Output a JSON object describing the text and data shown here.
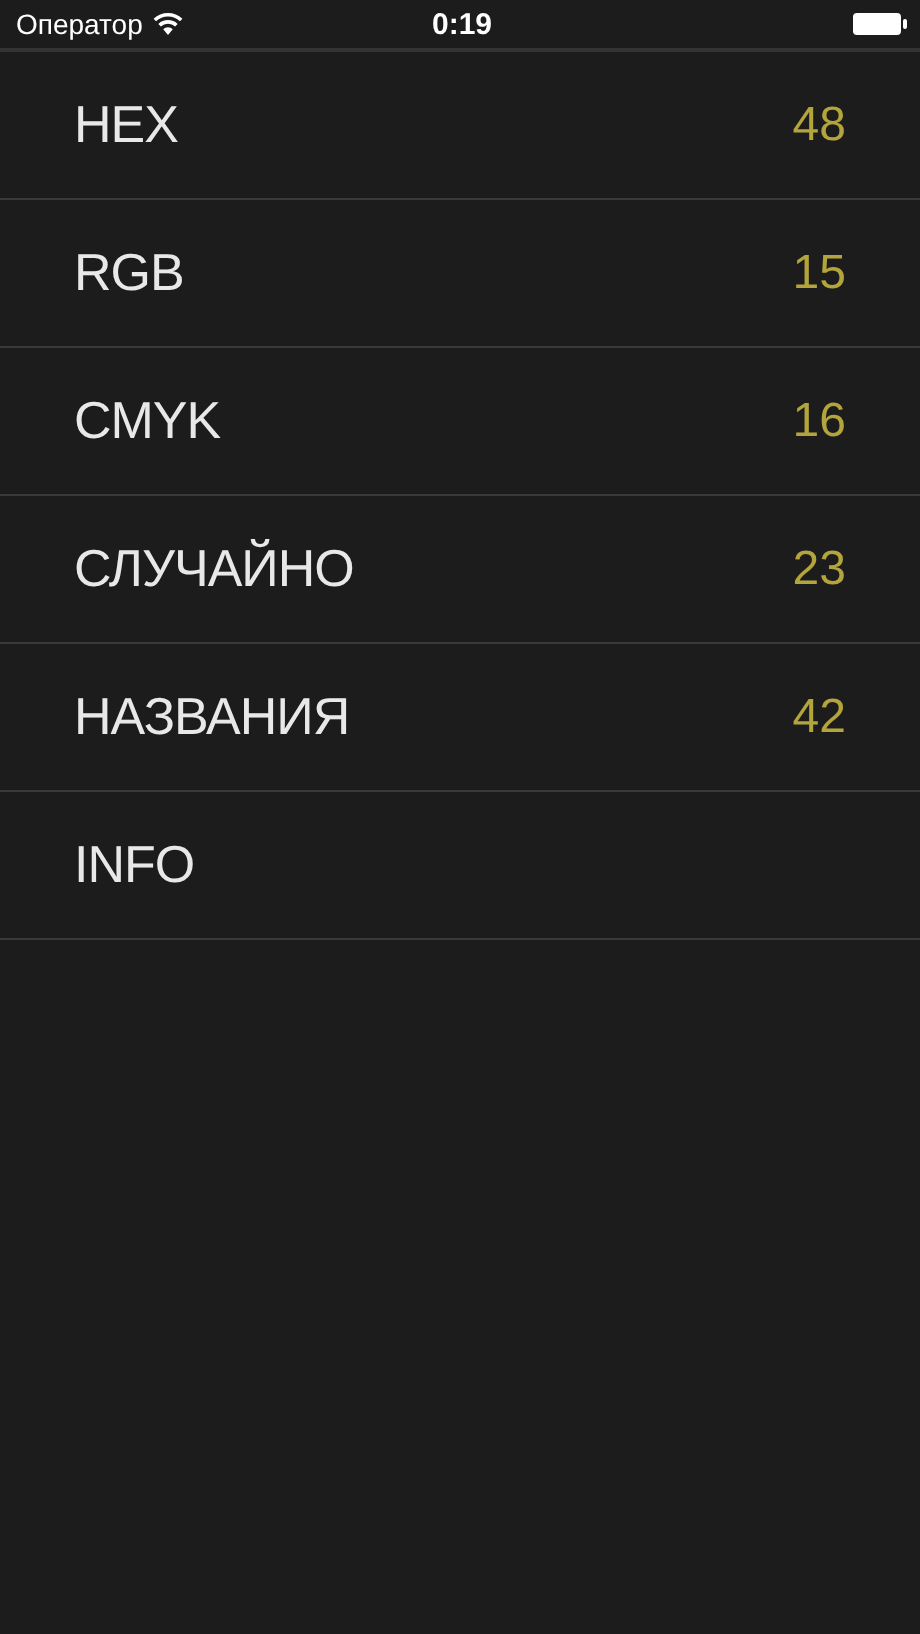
{
  "status_bar": {
    "carrier": "Оператор",
    "time": "0:19"
  },
  "menu": [
    {
      "label": "HEX",
      "count": "48"
    },
    {
      "label": "RGB",
      "count": "15"
    },
    {
      "label": "CMYK",
      "count": "16"
    },
    {
      "label": "СЛУЧАЙНО",
      "count": "23"
    },
    {
      "label": "НАЗВАНИЯ",
      "count": "42"
    },
    {
      "label": "INFO"
    }
  ]
}
